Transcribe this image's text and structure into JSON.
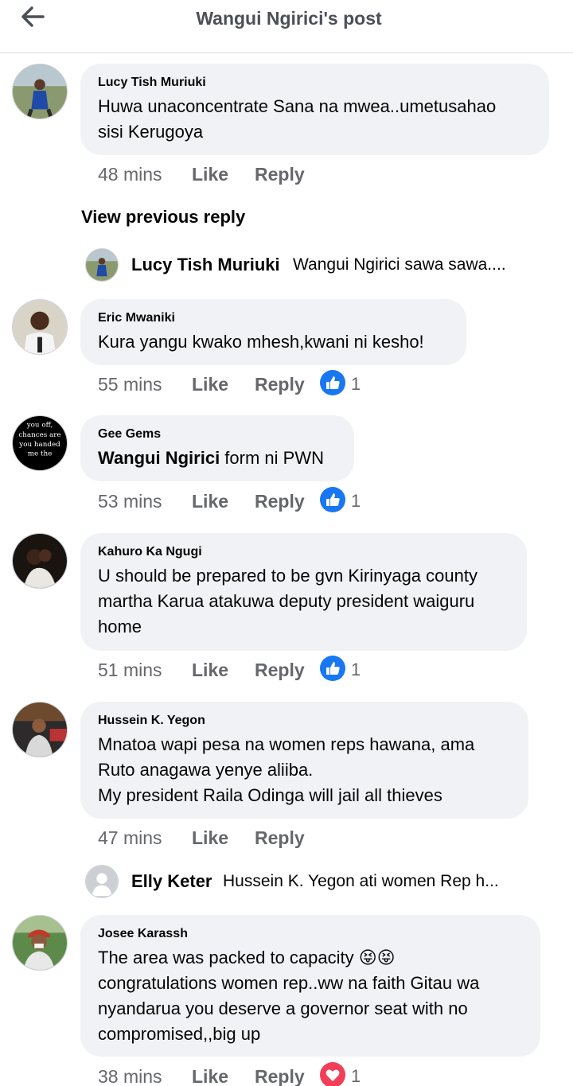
{
  "header": {
    "title": "Wangui Ngirici's post",
    "back_icon": "back-arrow-icon"
  },
  "view_previous": "View previous reply",
  "comments": [
    {
      "author": "Lucy Tish Muriuki",
      "text": "Huwa unaconcentrate Sana na mwea..umetusahao\nsisi Kerugoya",
      "time": "48 mins",
      "like": "Like",
      "reply": "Reply"
    },
    {
      "author": "Eric Mwaniki",
      "text": "Kura yangu kwako mhesh,kwani ni kesho!",
      "time": "55 mins",
      "like": "Like",
      "reply": "Reply",
      "reaction": "like",
      "reaction_count": "1"
    },
    {
      "author": "Gee Gems",
      "mention": "Wangui Ngirici",
      "text": " form ni PWN",
      "time": "53 mins",
      "like": "Like",
      "reply": "Reply",
      "reaction": "like",
      "reaction_count": "1",
      "avatar_text": "if I cu\nyou off,\nchances are\nyou handed\nme the\nscissors"
    },
    {
      "author": "Kahuro Ka Ngugi",
      "text": "U should be prepared to be gvn Kirinyaga county\nmartha Karua atakuwa deputy president waiguru\nhome",
      "time": "51 mins",
      "like": "Like",
      "reply": "Reply",
      "reaction": "like",
      "reaction_count": "1"
    },
    {
      "author": "Hussein K. Yegon",
      "text": "Mnatoa wapi pesa na women reps hawana,  ama\nRuto anagawa yenye aliiba.\nMy president Raila Odinga will jail all thieves",
      "time": "47 mins",
      "like": "Like",
      "reply": "Reply"
    },
    {
      "author": "Josee Karassh",
      "text": "The area was packed to capacity 😝😝\ncongratulations  women rep..ww na faith Gitau wa\nnyandarua you deserve a governor seat with no\ncompromised,,big up",
      "time": "38 mins",
      "like": "Like",
      "reply": "Reply",
      "reaction": "love",
      "reaction_count": "1"
    }
  ],
  "replies": [
    {
      "author": "Lucy Tish Muriuki",
      "text": "Wangui Ngirici sawa sawa...."
    },
    {
      "author": "Elly Keter",
      "text": "Hussein K. Yegon ati women Rep  h..."
    }
  ],
  "colors": {
    "like_blue": "#1877f2",
    "love_red": "#f33e58",
    "bubble_bg": "#f0f2f5",
    "meta_gray": "#65676b"
  }
}
